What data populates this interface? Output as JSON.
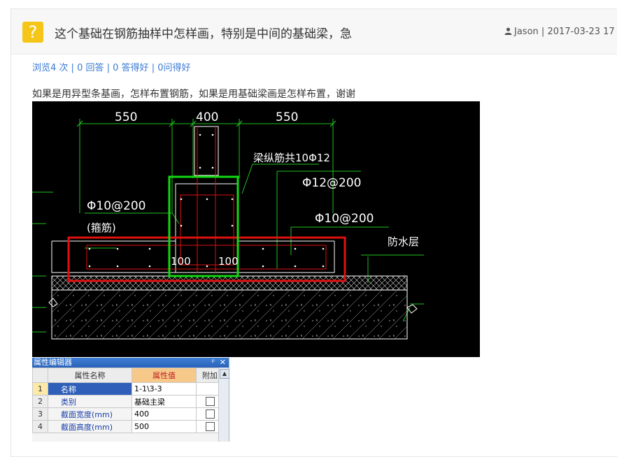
{
  "question": {
    "icon": "question-mark-icon",
    "icon_glyph": "?",
    "title": "这个基础在钢筋抽样中怎样画，特别是中间的基础梁，急",
    "author": "Jason",
    "date": "2017-03-23 17",
    "stats": {
      "views": "浏览4 次",
      "answers": "0 回答",
      "good_answers": "0 答得好",
      "good_questions": "0问得好",
      "sep": "|"
    },
    "body": "如果是用异型条基画，怎样布置钢筋，如果是用基础梁画是怎样布置，谢谢"
  },
  "drawing": {
    "dim_left": "550",
    "dim_mid": "400",
    "dim_right": "550",
    "label_beam_long": "梁纵筋共10Φ12",
    "label_phi12_200": "Φ12@200",
    "label_phi10_200_left": "Φ10@200",
    "label_stirrup": "(箍筋)",
    "label_phi10_200_right": "Φ10@200",
    "label_waterproof": "防水层",
    "label_100_left": "100",
    "label_100_right": "100",
    "colors": {
      "background": "#000000",
      "red": "#e01010",
      "green": "#12d812",
      "line": "#ffffff"
    }
  },
  "property_panel": {
    "title": "属性编辑器",
    "pin_icon": "pin-icon",
    "close_icon": "close-icon",
    "columns": [
      "属性名称",
      "属性值",
      "附加"
    ],
    "rows": [
      {
        "num": "1",
        "name": "名称",
        "value": "1-1\\3-3",
        "has_checkbox": false,
        "selected": true
      },
      {
        "num": "2",
        "name": "类别",
        "value": "基础主梁",
        "has_checkbox": true,
        "selected": false
      },
      {
        "num": "3",
        "name": "截面宽度(mm)",
        "value": "400",
        "has_checkbox": true,
        "selected": false
      },
      {
        "num": "4",
        "name": "截面高度(mm)",
        "value": "500",
        "has_checkbox": true,
        "selected": false
      }
    ]
  }
}
